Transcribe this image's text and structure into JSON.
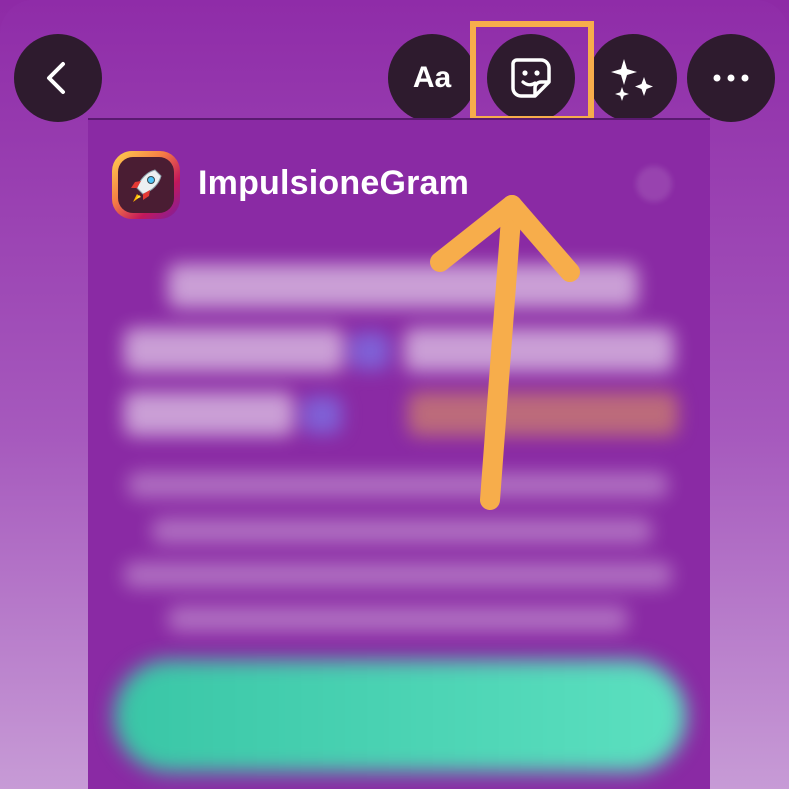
{
  "toolbar": {
    "back_icon": "chevron-left-icon",
    "text_label": "Aa",
    "sticker_icon": "sticker-icon",
    "effects_icon": "sparkles-icon",
    "more_icon": "more-horizontal-icon"
  },
  "card": {
    "app_name": "ImpulsioneGram",
    "app_icon": "rocket-icon"
  },
  "annotation": {
    "highlight_color": "#f7ad4b",
    "arrow_color": "#f7ad4b"
  },
  "colors": {
    "background_top": "#8f2ca8",
    "background_bottom": "#c79bd6",
    "card_bg": "#8a2aa4",
    "button_bg": "#2e1b2e",
    "cta": "#39c6a6"
  }
}
